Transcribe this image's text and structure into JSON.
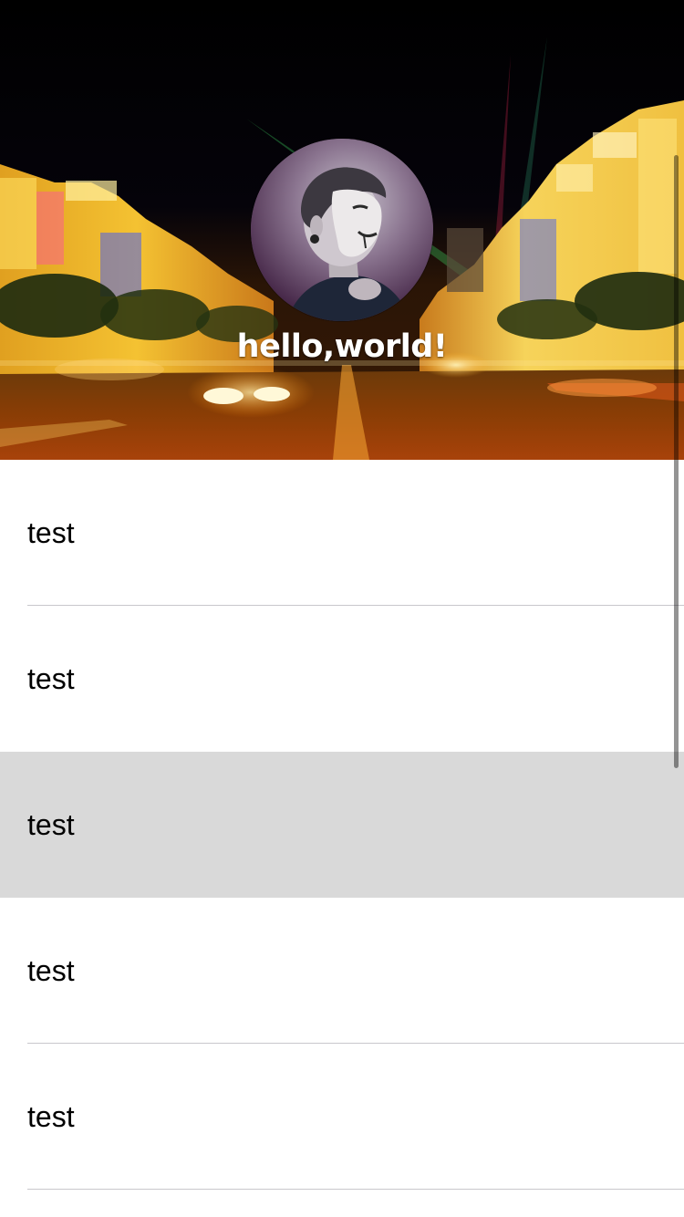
{
  "header": {
    "background": "night-city-street-image",
    "avatar": "masked-person-avatar",
    "username": "hello,world!"
  },
  "list": {
    "items": [
      {
        "label": "test",
        "highlighted": false
      },
      {
        "label": "test",
        "highlighted": false
      },
      {
        "label": "test",
        "highlighted": true
      },
      {
        "label": "test",
        "highlighted": false
      },
      {
        "label": "test",
        "highlighted": false
      }
    ]
  },
  "colors": {
    "highlight": "#d9d9d9",
    "separator": "#c8c7cc",
    "text": "#000000"
  }
}
